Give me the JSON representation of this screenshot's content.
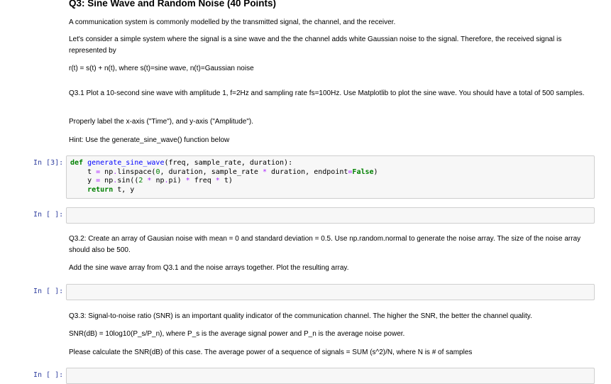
{
  "notebook": {
    "title": "Q3: Sine Wave and Random Noise (40 Points)",
    "intro": "A communication system is commonly modelled by the transmitted signal, the channel, and the receiver.",
    "system_desc": "Let's consider a simple system where the signal is a sine wave and the the channel adds white Gaussian noise to the signal. Therefore, the received signal is represented by",
    "equation": "r(t) = s(t) + n(t), where s(t)=sine wave, n(t)=Gaussian noise",
    "q31": "Q3.1 Plot a 10-second sine wave with amplitude 1, f=2Hz and sampling rate fs=100Hz. Use Matplotlib to plot the sine wave. You should have a total of 500 samples.",
    "q31_label": "Properly label the x-axis (\"Time\"), and y-axis (\"Amplitude\").",
    "q31_hint": "Hint: Use the generate_sine_wave() function below",
    "q32": "Q3.2: Create an array of Gausian noise with mean = 0 and standard deviation = 0.5. Use np.random.normal to generate the noise array. The size of the noise array should also be 500.",
    "q32_add": "Add the sine wave array from Q3.1 and the noise arrays together. Plot the resulting array.",
    "q33": "Q3.3: Signal-to-noise ratio (SNR) is an important quality indicator of the communication channel. The higher the SNR, the better the channel quality.",
    "q33_formula": "SNR(dB) = 10log10(P_s/P_n), where P_s is the average signal power and P_n is the average noise power.",
    "q33_calc": "Please calculate the SNR(dB) of this case. The average power of a sequence of signals = SUM (s^2)/N, where N is # of samples"
  },
  "cells": {
    "code_prompt": "In [3]:",
    "empty_prompt_1": "In [ ]:",
    "empty_prompt_2": "In [ ]:",
    "empty_prompt_3": "In [ ]:"
  },
  "colors": {
    "prompt": "#303f9f",
    "keyword": "#008000",
    "function": "#0000ff",
    "operator": "#aa22ff"
  }
}
